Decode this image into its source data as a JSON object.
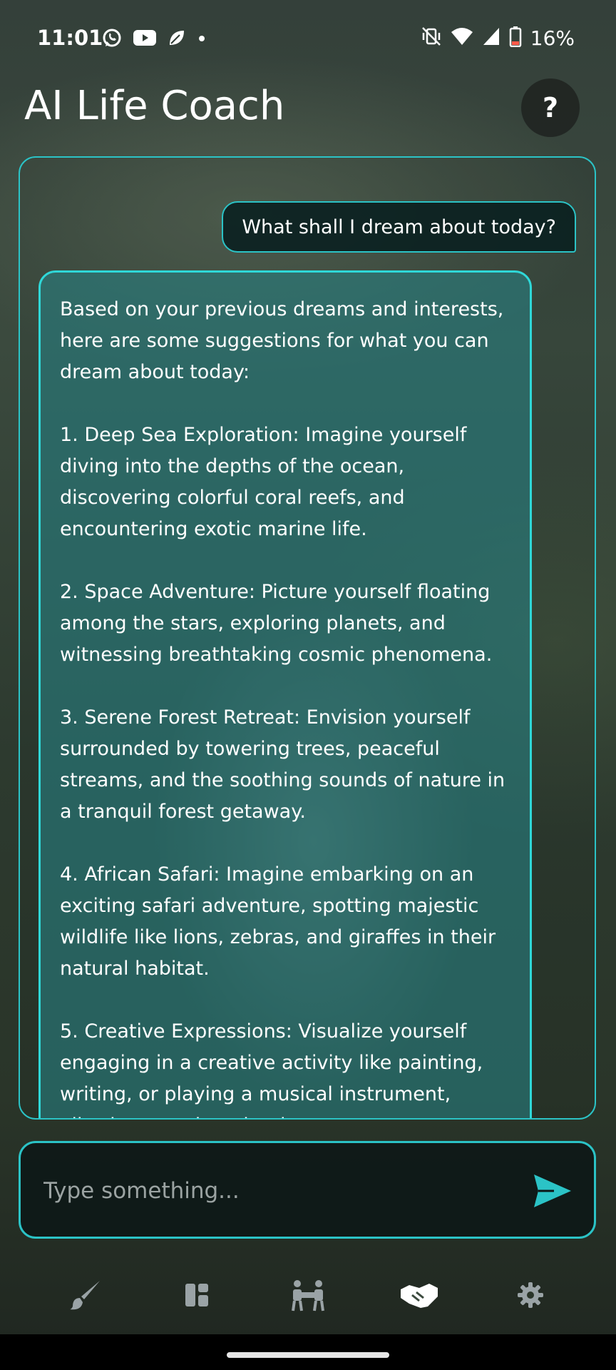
{
  "status_bar": {
    "time": "11:01",
    "notification_icons": [
      "whatsapp-icon",
      "youtube-icon",
      "leaf-icon",
      "dot-icon"
    ],
    "system_icons": [
      "vibrate-off-icon",
      "wifi-icon",
      "signal-icon",
      "battery-low-icon"
    ],
    "battery": "16%"
  },
  "header": {
    "title": "AI Life Coach",
    "help_label": "?"
  },
  "chat": {
    "user_message": "What shall I dream about today?",
    "ai_message": "Based on your previous dreams and interests, here are some suggestions for what you can dream about today:\n\n1. Deep Sea Exploration: Imagine yourself diving into the depths of the ocean, discovering colorful coral reefs, and encountering exotic marine life.\n\n2. Space Adventure: Picture yourself floating among the stars, exploring planets, and witnessing breathtaking cosmic phenomena.\n\n3. Serene Forest Retreat: Envision yourself surrounded by towering trees, peaceful streams, and the soothing sounds of nature in a tranquil forest getaway.\n\n4. African Safari: Imagine embarking on an exciting safari adventure, spotting majestic wildlife like lions, zebras, and giraffes in their natural habitat.\n\n5. Creative Expressions: Visualize yourself engaging in a creative activity like painting, writing, or playing a musical instrument, allowing your imagination to soar."
  },
  "input": {
    "placeholder": "Type something...",
    "value": "",
    "send_icon": "send-icon"
  },
  "bottom_nav": {
    "items": [
      "brush-icon",
      "dashboard-icon",
      "people-icon",
      "handshake-icon",
      "gear-icon"
    ]
  },
  "colors": {
    "accent": "#2bc3c6",
    "ai_bubble": "#2a7f80",
    "nav_icon": "#9aa3a6"
  }
}
